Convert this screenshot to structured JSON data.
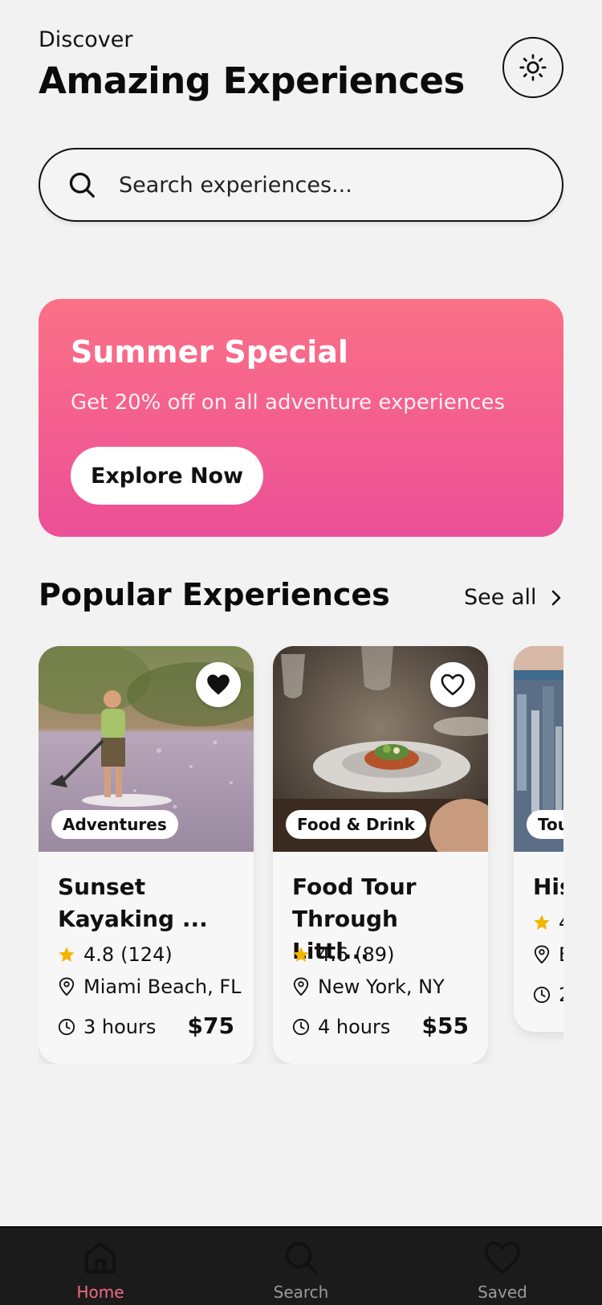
{
  "header": {
    "eyebrow": "Discover",
    "title": "Amazing Experiences",
    "theme_icon": "sun-icon"
  },
  "search": {
    "placeholder": "Search experiences...",
    "icon": "search-icon"
  },
  "promo": {
    "title": "Summer Special",
    "subtitle": "Get 20% off on all adventure experiences",
    "button": "Explore Now",
    "gradient": [
      "#fb7186",
      "#ec4f97"
    ]
  },
  "popular": {
    "title": "Popular Experiences",
    "see_all": "See all",
    "cards": [
      {
        "category": "Adventures",
        "name": "Sunset\nKayaking ...",
        "rating": "4.8",
        "reviews": "(124)",
        "location": "Miami Beach, FL",
        "duration": "3 hours",
        "price": "$75",
        "favorited": true
      },
      {
        "category": "Food & Drink",
        "name": "Food Tour\nThrough Littl...",
        "rating": "4.6",
        "reviews": "(89)",
        "location": "New York, NY",
        "duration": "4 hours",
        "price": "$55",
        "favorited": false
      },
      {
        "category": "Tou",
        "name": "His",
        "rating": "4",
        "reviews": "",
        "location": "E",
        "duration": "2",
        "price": "",
        "favorited": false
      }
    ]
  },
  "nav": {
    "items": [
      {
        "label": "Home",
        "icon": "home-icon",
        "active": true
      },
      {
        "label": "Search",
        "icon": "search-icon",
        "active": false
      },
      {
        "label": "Saved",
        "icon": "heart-icon",
        "active": false
      }
    ]
  },
  "colors": {
    "accent": "#f06b86",
    "star": "#f5b400",
    "nav_bg": "#1c1b1b"
  }
}
